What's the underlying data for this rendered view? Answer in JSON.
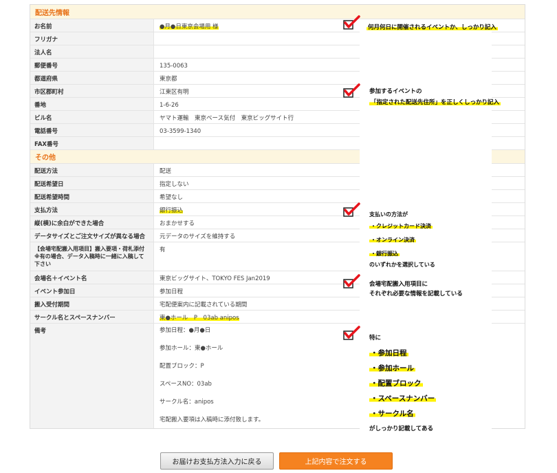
{
  "shipping_section": {
    "title": "配送先情報",
    "rows": [
      {
        "label": "お名前",
        "value": "●月●日東京会場用 様"
      },
      {
        "label": "フリガナ",
        "value": ""
      },
      {
        "label": "法人名",
        "value": ""
      },
      {
        "label": "郵便番号",
        "value": "135-0063"
      },
      {
        "label": "都道府県",
        "value": "東京都"
      },
      {
        "label": "市区郡町村",
        "value": "江東区有明"
      },
      {
        "label": "番地",
        "value": "1-6-26"
      },
      {
        "label": "ビル名",
        "value": "ヤマト運輸　東京ベース気付　東京ビッグサイト行"
      },
      {
        "label": "電話番号",
        "value": "03-3599-1340"
      },
      {
        "label": "FAX番号",
        "value": ""
      }
    ]
  },
  "other_section": {
    "title": "その他",
    "rows": [
      {
        "label": "配送方法",
        "value": "配送"
      },
      {
        "label": "配送希望日",
        "value": "指定しない"
      },
      {
        "label": "配送希望時間",
        "value": "希望なし"
      },
      {
        "label": "支払方法",
        "value": "銀行振込"
      },
      {
        "label": "縦(横)に余白ができた場合",
        "value": "おまかせする"
      },
      {
        "label": "データサイズとご注文サイズが異なる場合",
        "value": "元データのサイズを維持する"
      },
      {
        "label": "【会場宅配搬入用項目】搬入要項・荷札添付　※有の場合、データ入稿時に一緒に入稿して下さい",
        "value": "有"
      },
      {
        "label": "会場名＋イベント名",
        "value": "東京ビッグサイト、TOKYO FES Jan2019"
      },
      {
        "label": "イベント参加日",
        "value": "参加日程"
      },
      {
        "label": "搬入受付期間",
        "value": "宅配便案内に記載されている期間"
      },
      {
        "label": "サークル名とスペースナンバー",
        "value": "東●ホール　P　03ab anipos"
      }
    ],
    "notes": {
      "label": "備考",
      "lines": [
        "参加日程：●月●日",
        "参加ホール：東●ホール",
        "配置ブロック：P",
        "スペースNO：03ab",
        "サークル名：anipos",
        "宅配搬入要項は入稿時に添付致します。"
      ]
    }
  },
  "annotations": {
    "a1": "何月何日に開催されるイベントか、しっかり記入",
    "a2_line1": "参加するイベントの",
    "a2_line2": "「指定された配送先住所」を正しくしっかり記入",
    "a3_intro": "支払いの方法が",
    "a3_items": [
      "・クレジットカード決済",
      "・オンライン決済",
      "・銀行振込"
    ],
    "a3_outro": "のいずれかを選択している",
    "a4_line1": "会場宅配搬入用項目に",
    "a4_line2": "それぞれ必要な情報を記載している",
    "a5_intro": "特に",
    "a5_items": [
      "・参加日程",
      "・参加ホール",
      "・配置ブロック",
      "・スペースナンバー",
      "・サークル名"
    ],
    "a5_outro": "がしっかり記載してある"
  },
  "buttons": {
    "back": "お届けお支払方法入力に戻る",
    "order": "上記内容で注文する"
  },
  "colors": {
    "accent": "#f58220",
    "section_title": "#e8731a",
    "highlight": "#fff200",
    "check": "#e8141c"
  }
}
